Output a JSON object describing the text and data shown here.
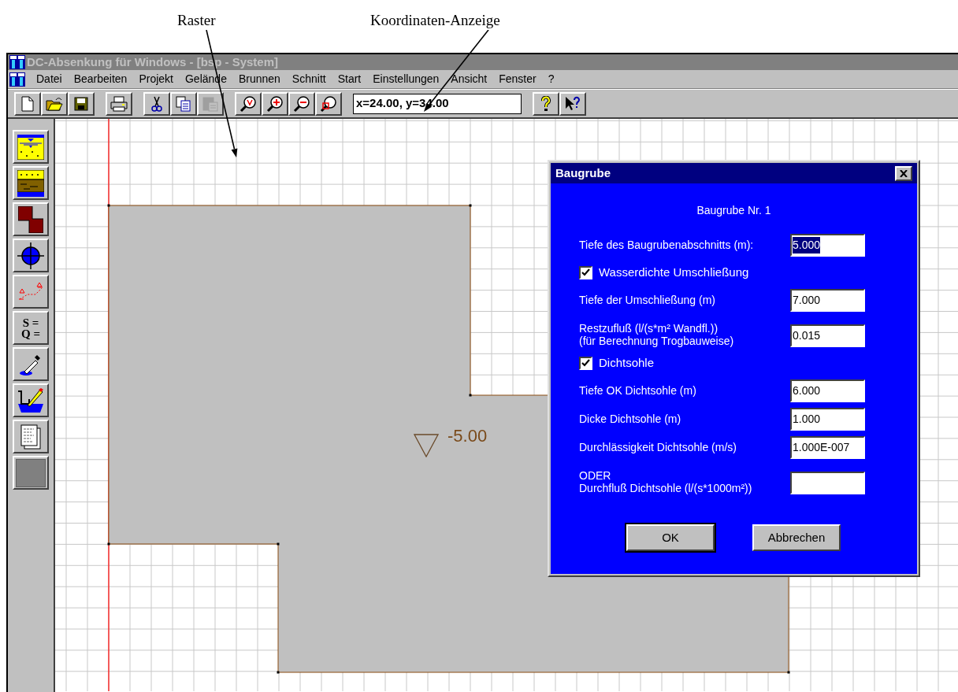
{
  "annotations": [
    {
      "text": "Raster"
    },
    {
      "text": "Koordinaten-Anzeige"
    }
  ],
  "window": {
    "title": "DC-Absenkung für Windows - [bsp - System]",
    "active": false
  },
  "menu": [
    {
      "label": "Datei"
    },
    {
      "label": "Bearbeiten"
    },
    {
      "label": "Projekt"
    },
    {
      "label": "Gelände"
    },
    {
      "label": "Brunnen"
    },
    {
      "label": "Schnitt"
    },
    {
      "label": "Start"
    },
    {
      "label": "Einstellungen"
    },
    {
      "label": "Ansicht"
    },
    {
      "label": "Fenster"
    },
    {
      "label": "?"
    }
  ],
  "toolbar": {
    "groups": [
      [
        {
          "kind": "new",
          "disabled": false
        },
        {
          "kind": "open",
          "disabled": false
        },
        {
          "kind": "save",
          "disabled": false
        }
      ],
      [
        {
          "kind": "print",
          "disabled": false
        }
      ],
      [
        {
          "kind": "cut",
          "disabled": false
        },
        {
          "kind": "copy",
          "disabled": false
        },
        {
          "kind": "paste",
          "disabled": true
        }
      ],
      [
        {
          "kind": "zoom-all",
          "disabled": false
        },
        {
          "kind": "zoom-in",
          "disabled": false
        },
        {
          "kind": "zoom-out",
          "disabled": false
        },
        {
          "kind": "zoom-window",
          "disabled": false
        }
      ]
    ],
    "coordinates": "x=24.00, y=34.00",
    "help": [
      {
        "kind": "help",
        "disabled": false
      },
      {
        "kind": "context-help",
        "disabled": false
      }
    ]
  },
  "side_toolbar": [
    {
      "kind": "water-layer"
    },
    {
      "kind": "soil-layers"
    },
    {
      "kind": "pit"
    },
    {
      "kind": "well"
    },
    {
      "kind": "section"
    },
    {
      "kind": "formula",
      "lines": [
        "S =",
        "Q ="
      ]
    },
    {
      "kind": "dropper"
    },
    {
      "kind": "edit-pit"
    },
    {
      "kind": "report"
    },
    {
      "kind": "blank"
    }
  ],
  "canvas": {
    "level_label": "-5.00"
  },
  "dialog": {
    "title": "Baugrube",
    "heading": "Baugrube Nr. 1",
    "rows": [
      {
        "kind": "field",
        "lines": [
          "Tiefe des Baugrubenabschnitts (m):"
        ],
        "value": "5.000",
        "selected": true
      },
      {
        "kind": "checkbox",
        "label": "Wasserdichte Umschließung",
        "checked": true
      },
      {
        "kind": "field",
        "lines": [
          "Tiefe der Umschließung (m)"
        ],
        "value": "7.000",
        "selected": false
      },
      {
        "kind": "field",
        "lines": [
          "Restzufluß (l/(s*m² Wandfl.))",
          "(für Berechnung Trogbauweise)"
        ],
        "value": "0.015",
        "selected": false
      },
      {
        "kind": "checkbox",
        "label": "Dichtsohle",
        "checked": true
      },
      {
        "kind": "field",
        "lines": [
          "Tiefe OK Dichtsohle (m)"
        ],
        "value": "6.000",
        "selected": false
      },
      {
        "kind": "field",
        "lines": [
          "Dicke Dichtsohle (m)"
        ],
        "value": "1.000",
        "selected": false
      },
      {
        "kind": "field",
        "lines": [
          "Durchlässigkeit Dichtsohle (m/s)"
        ],
        "value": "1.000E-007",
        "selected": false
      },
      {
        "kind": "field",
        "lines": [
          "ODER",
          "Durchfluß Dichtsohle (l/(s*1000m²))"
        ]
      }
    ],
    "buttons": [
      {
        "label": "OK",
        "default": true
      },
      {
        "label": "Abbrechen",
        "default": false
      }
    ]
  }
}
